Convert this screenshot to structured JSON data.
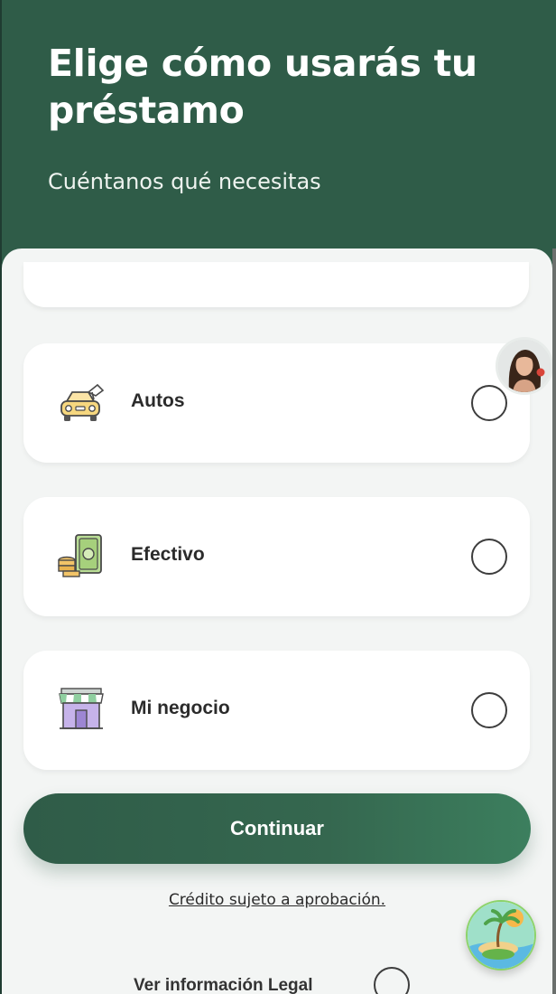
{
  "header": {
    "title": "Elige cómo usarás tu préstamo",
    "subtitle": "Cuéntanos qué necesitas"
  },
  "options": [
    {
      "label": "Autos",
      "icon": "car-icon",
      "selected": false
    },
    {
      "label": "Efectivo",
      "icon": "cash-icon",
      "selected": false
    },
    {
      "label": "Mi negocio",
      "icon": "store-icon",
      "selected": false
    }
  ],
  "cta": {
    "label": "Continuar"
  },
  "disclaimer": "Crédito sujeto a aprobación.",
  "legal": {
    "label": "Ver información Legal"
  },
  "colors": {
    "brand": "#2f5c48",
    "sheet": "#f3f5f4",
    "card": "#ffffff",
    "text": "#2b2b2b"
  }
}
